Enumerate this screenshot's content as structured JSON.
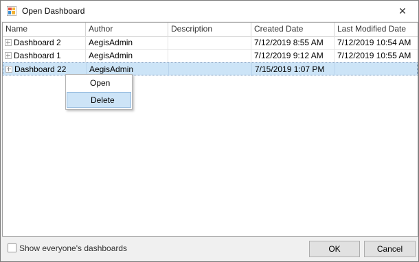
{
  "window": {
    "title": "Open Dashboard",
    "close_glyph": "✕"
  },
  "grid": {
    "columns": [
      "Name",
      "Author",
      "Description",
      "Created Date",
      "Last Modified Date"
    ],
    "rows": [
      {
        "name": "Dashboard 2",
        "author": "AegisAdmin",
        "description": "",
        "created": "7/12/2019 8:55 AM",
        "modified": "7/12/2019 10:54 AM",
        "selected": false
      },
      {
        "name": "Dashboard 1",
        "author": "AegisAdmin",
        "description": "",
        "created": "7/12/2019 9:12 AM",
        "modified": "7/12/2019 10:55 AM",
        "selected": false
      },
      {
        "name": "Dashboard 22",
        "author": "AegisAdmin",
        "description": "",
        "created": "7/15/2019 1:07 PM",
        "modified": "",
        "selected": true
      }
    ]
  },
  "context_menu": {
    "items": [
      "Open",
      "Delete"
    ],
    "highlighted": "Delete"
  },
  "footer": {
    "checkbox_label": "Show everyone's dashboards",
    "checkbox_checked": false,
    "ok_label": "OK",
    "cancel_label": "Cancel"
  },
  "colors": {
    "selection": "#cce4f7",
    "menu_highlight": "#cde4f7"
  },
  "icons": {
    "app": "dashboard-icon",
    "close": "close-icon",
    "row_expander": "expand-plus-icon"
  }
}
